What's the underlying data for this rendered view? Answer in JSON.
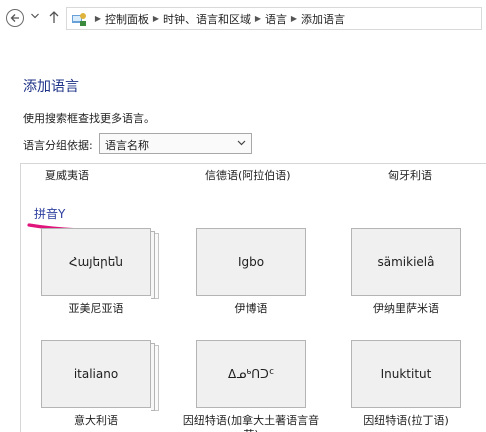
{
  "breadcrumb": {
    "items": [
      "控制面板",
      "时钟、语言和区域",
      "语言",
      "添加语言"
    ]
  },
  "page": {
    "title": "添加语言",
    "hint": "使用搜索框查找更多语言。",
    "group_label": "语言分组依据:",
    "group_value": "语言名称"
  },
  "previous_row": [
    "夏威夷语",
    "信德语(阿拉伯语)",
    "匈牙利语"
  ],
  "section": {
    "header": "拼音Y",
    "tiles": [
      {
        "native": "Հայերեն",
        "name": "亚美尼亚语"
      },
      {
        "native": "Igbo",
        "name": "伊博语"
      },
      {
        "native": "sämikielâ",
        "name": "伊纳里萨米语"
      },
      {
        "native": "italiano",
        "name": "意大利语"
      },
      {
        "native": "ᐃᓄᒃᑎᑐᑦ",
        "name": "因纽特语(加拿大土著语言音节)"
      },
      {
        "native": "Inuktitut",
        "name": "因纽特语(拉丁语)"
      }
    ]
  },
  "colors": {
    "title": "#1e3287",
    "section": "#2c3e9e",
    "mark": "#e0147a"
  }
}
